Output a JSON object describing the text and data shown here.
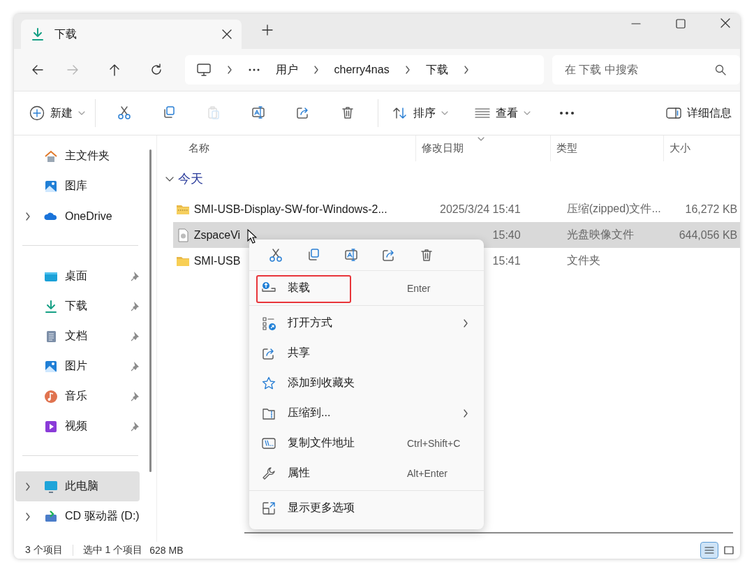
{
  "tab": {
    "title": "下载",
    "selected": true
  },
  "nav_buttons": [
    {
      "kind": "back",
      "disabled": false
    },
    {
      "kind": "forward",
      "disabled": true
    },
    {
      "kind": "up",
      "disabled": false
    },
    {
      "kind": "refresh",
      "disabled": false
    }
  ],
  "address": {
    "crumbs": [
      "用户",
      "cherry4nas",
      "下载"
    ]
  },
  "search": {
    "placeholder": "在 下载 中搜索"
  },
  "toolbar": {
    "new_label": "新建",
    "actions": [
      {
        "kind": "cut",
        "disabled": false
      },
      {
        "kind": "copy",
        "disabled": false
      },
      {
        "kind": "paste",
        "disabled": true
      },
      {
        "kind": "rename",
        "disabled": false
      },
      {
        "kind": "share",
        "disabled": false
      },
      {
        "kind": "delete",
        "disabled": false
      }
    ],
    "sort_label": "排序",
    "view_label": "查看",
    "details_label": "详细信息"
  },
  "sidebar": {
    "groups": [
      [
        {
          "label": "主文件夹",
          "expandable": false,
          "pinned": false,
          "selected": false
        },
        {
          "label": "图库",
          "expandable": false,
          "pinned": false,
          "selected": false
        },
        {
          "label": "OneDrive",
          "expandable": true,
          "pinned": false,
          "selected": false
        }
      ],
      [
        {
          "label": "桌面",
          "expandable": false,
          "pinned": true,
          "selected": false
        },
        {
          "label": "下载",
          "expandable": false,
          "pinned": true,
          "selected": false
        },
        {
          "label": "文档",
          "expandable": false,
          "pinned": true,
          "selected": false
        },
        {
          "label": "图片",
          "expandable": false,
          "pinned": true,
          "selected": false
        },
        {
          "label": "音乐",
          "expandable": false,
          "pinned": true,
          "selected": false
        },
        {
          "label": "视频",
          "expandable": false,
          "pinned": true,
          "selected": false
        }
      ],
      [
        {
          "label": "此电脑",
          "expandable": true,
          "pinned": false,
          "selected": true
        },
        {
          "label": "CD 驱动器 (D:)",
          "expandable": true,
          "pinned": false,
          "selected": false
        }
      ]
    ]
  },
  "columns": [
    {
      "label": "名称",
      "sorted": false
    },
    {
      "label": "修改日期",
      "sorted": true
    },
    {
      "label": "类型",
      "sorted": false
    },
    {
      "label": "大小",
      "sorted": false
    }
  ],
  "file_groups": [
    {
      "label": "今天",
      "expanded": true,
      "rows": [
        {
          "kind": "zip",
          "name": "SMI-USB-Display-SW-for-Windows-2...",
          "date": "2025/3/24 15:41",
          "type": "压缩(zipped)文件...",
          "size": "16,272 KB",
          "selected": false
        },
        {
          "kind": "disc",
          "name": "ZspaceVi",
          "date": "15:40",
          "type": "光盘映像文件",
          "size": "644,056 KB",
          "selected": true
        },
        {
          "kind": "folder",
          "name": "SMI-USB",
          "date": "15:41",
          "type": "文件夹",
          "selected": false
        }
      ]
    }
  ],
  "context_menu": {
    "quick_actions": [
      {
        "kind": "cut"
      },
      {
        "kind": "copy"
      },
      {
        "kind": "rename"
      },
      {
        "kind": "share"
      },
      {
        "kind": "delete"
      }
    ],
    "sections": [
      [
        {
          "label": "装载",
          "shortcut": "Enter",
          "highlighted": true,
          "submenu": false
        }
      ],
      [
        {
          "label": "打开方式",
          "submenu": true,
          "highlighted": false
        },
        {
          "label": "共享",
          "submenu": false,
          "highlighted": false
        },
        {
          "label": "添加到收藏夹",
          "submenu": false,
          "highlighted": false
        },
        {
          "label": "压缩到...",
          "submenu": true,
          "highlighted": false
        },
        {
          "label": "复制文件地址",
          "shortcut": "Ctrl+Shift+C",
          "submenu": false,
          "highlighted": false
        },
        {
          "label": "属性",
          "shortcut": "Alt+Enter",
          "submenu": false,
          "highlighted": false
        }
      ],
      [
        {
          "label": "显示更多选项",
          "submenu": false,
          "highlighted": false
        }
      ]
    ]
  },
  "status_bar": {
    "count": "3 个项目",
    "selection": "选中 1 个项目",
    "size": "628 MB",
    "views": [
      {
        "kind": "details",
        "selected": true
      },
      {
        "kind": "tiles",
        "selected": false
      }
    ]
  }
}
